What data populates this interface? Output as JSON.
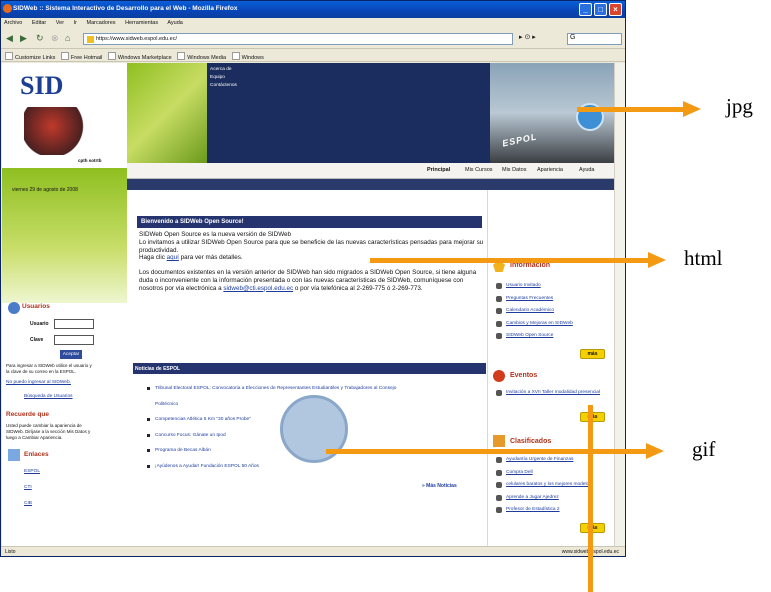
{
  "window": {
    "title": "SIDWeb :: Sistema Interactivo de Desarrollo para el Web - Mozilla Firefox"
  },
  "menu": [
    "Archivo",
    "Editar",
    "Ver",
    "Ir",
    "Marcadores",
    "Herramientas",
    "Ayuda"
  ],
  "address": {
    "url": "https://www.sidweb.espol.edu.ec/",
    "search": "G"
  },
  "bookmarks": [
    "Customize Links",
    "Free Hotmail",
    "Windows Marketplace",
    "Windows Media",
    "Windows"
  ],
  "status": {
    "left": "Listo",
    "right": "www.sidweb.espol.edu.ec"
  },
  "header": {
    "logo": "SID",
    "logo_sub": "cpth sotrtb",
    "links": [
      "Acerca de",
      "Equipo",
      "Contáctenos"
    ],
    "sign": "ESPOL"
  },
  "tabs": [
    "Principal",
    "Mis Cursos",
    "Mis Datos",
    "Apariencia",
    "Ayuda"
  ],
  "date": "viernes 29 de agosto de 2008",
  "welcome": {
    "title": "Bienvenido a SIDWeb Open Source!",
    "p1": "SIDWeb Open Source es la nueva versión de SIDWeb",
    "p2": "Lo invitamos a utilizar SIDWeb Open Source para que se beneficie de las nuevas características pensadas para mejorar su productividad.",
    "p3_pre": "Haga clic",
    "p3_link": "aquí",
    "p3_post": "para ver más detalles.",
    "p4": "Los documentos existentes en la versión anterior de SIDWeb han sido migrados a SIDWeb Open Source, si tiene alguna duda o inconveniente con la información presentada o con las nuevas características de SIDWeb, comuníquese con nosotros por vía electrónica a",
    "p4_link": "sidweb@cti.espol.edu.ec",
    "p4_post": "o por vía telefónica al 2-269-775 ó 2-269-773."
  },
  "news": {
    "title": "Noticias de ESPOL",
    "items": [
      "Tribunal Electoral ESPOL: Convocatoria a Elecciones de Representantes Estudiantiles y Trabajadores al Consejo Politécnico",
      "Competencias Atlética 5 Km \"30 años Probe\"",
      "Concurso Focus: Gánate un Ipod",
      "Programa de Becas Albán",
      "¡Ayúdenos a Ayudar! Fundación ESPOL 50 Años"
    ],
    "more": "» Más Noticias"
  },
  "right": {
    "info_title": "Información",
    "info_items": [
      "Usuario Invitado",
      "Preguntas Frecuentes",
      "Calendario Académico",
      "Cambios y Mejoras en SIDWeb",
      "SIDWeb Open Source"
    ],
    "eventos_title": "Eventos",
    "eventos_items": [
      "Invitación a XVII Taller modalidad presencial"
    ],
    "clasif_title": "Clasificados",
    "clasif_items": [
      "Ayudantía Urgente de Finanzas",
      "Compra Dell",
      "celulares baratos y los mejores modelos",
      "Aprende a Jugar Ajedrez",
      "Profesor de Estadística 2"
    ],
    "mas": "más"
  },
  "left": {
    "usuarios_title": "Usuarios",
    "user_label": "Usuario",
    "pass_label": "Clave",
    "login_btn": "Aceptar",
    "login_help": "Para ingresar a SIDWeb utilice el usuario y la clave de su correo en la ESPOL.",
    "login_link": "No puedo ingresar al SIDWeb.",
    "search_users": "Búsqueda de Usuarios",
    "recuerde_title": "Recuerde que",
    "recuerde_text": "Usted puede cambiar la apariencia de SIDWeb. Diríjase a la sección Mis Datos y luego a Cambiar Apariencia.",
    "enlaces_title": "Enlaces",
    "enlaces": [
      "ESPOL",
      "CTI",
      "CIB"
    ]
  },
  "annotations": [
    "jpg",
    "html",
    "gif"
  ]
}
